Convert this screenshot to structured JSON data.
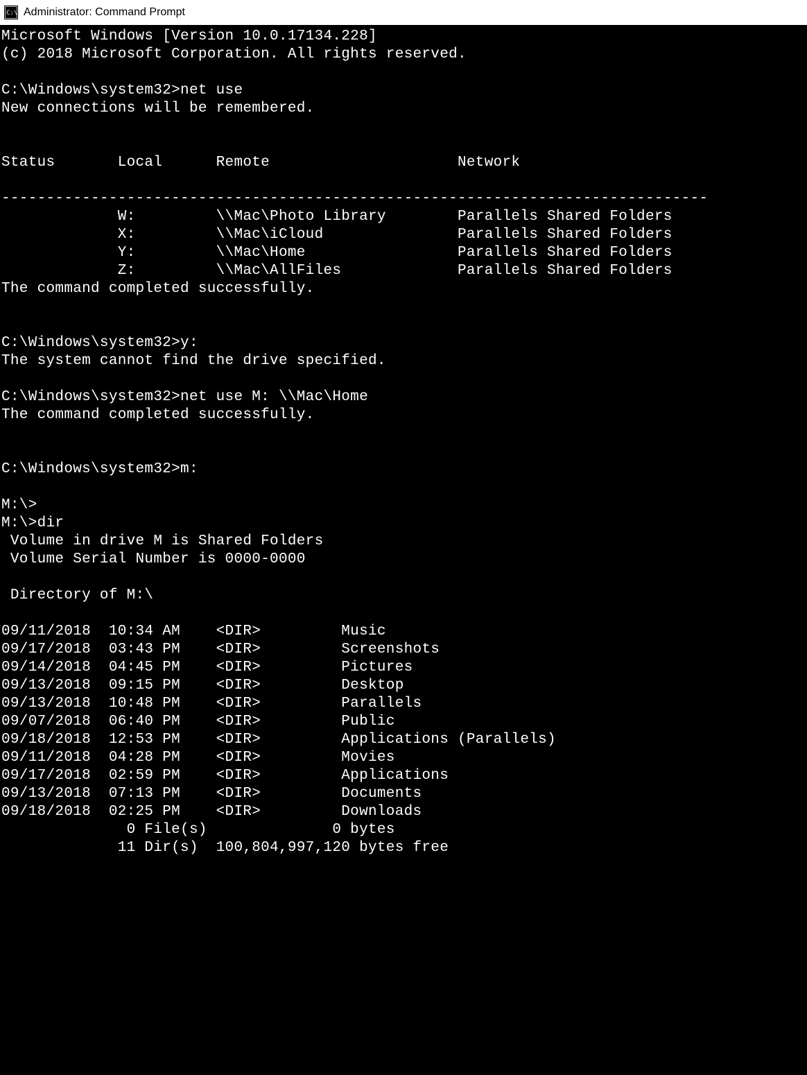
{
  "titlebar": {
    "title": "Administrator: Command Prompt"
  },
  "terminal": {
    "header_line1": "Microsoft Windows [Version 10.0.17134.228]",
    "header_line2": "(c) 2018 Microsoft Corporation. All rights reserved.",
    "prompt_path": "C:\\Windows\\system32>",
    "cmd_net_use": "net use",
    "net_use_msg": "New connections will be remembered.",
    "net_use_headers": {
      "status": "Status",
      "local": "Local",
      "remote": "Remote",
      "network": "Network"
    },
    "net_use_rows": [
      {
        "local": "W:",
        "remote": "\\\\Mac\\Photo Library",
        "network": "Parallels Shared Folders"
      },
      {
        "local": "X:",
        "remote": "\\\\Mac\\iCloud",
        "network": "Parallels Shared Folders"
      },
      {
        "local": "Y:",
        "remote": "\\\\Mac\\Home",
        "network": "Parallels Shared Folders"
      },
      {
        "local": "Z:",
        "remote": "\\\\Mac\\AllFiles",
        "network": "Parallels Shared Folders"
      }
    ],
    "cmd_success": "The command completed successfully.",
    "cmd_y": "y:",
    "err_drive": "The system cannot find the drive specified.",
    "cmd_net_use_m": "net use M: \\\\Mac\\Home",
    "cmd_m": "m:",
    "prompt_m": "M:\\>",
    "cmd_dir": "dir",
    "dir_vol1": " Volume in drive M is Shared Folders",
    "dir_vol2": " Volume Serial Number is 0000-0000",
    "dir_of": " Directory of M:\\",
    "dir_rows": [
      {
        "date": "09/11/2018",
        "time": "10:34 AM",
        "type": "<DIR>",
        "name": "Music"
      },
      {
        "date": "09/17/2018",
        "time": "03:43 PM",
        "type": "<DIR>",
        "name": "Screenshots"
      },
      {
        "date": "09/14/2018",
        "time": "04:45 PM",
        "type": "<DIR>",
        "name": "Pictures"
      },
      {
        "date": "09/13/2018",
        "time": "09:15 PM",
        "type": "<DIR>",
        "name": "Desktop"
      },
      {
        "date": "09/13/2018",
        "time": "10:48 PM",
        "type": "<DIR>",
        "name": "Parallels"
      },
      {
        "date": "09/07/2018",
        "time": "06:40 PM",
        "type": "<DIR>",
        "name": "Public"
      },
      {
        "date": "09/18/2018",
        "time": "12:53 PM",
        "type": "<DIR>",
        "name": "Applications (Parallels)"
      },
      {
        "date": "09/11/2018",
        "time": "04:28 PM",
        "type": "<DIR>",
        "name": "Movies"
      },
      {
        "date": "09/17/2018",
        "time": "02:59 PM",
        "type": "<DIR>",
        "name": "Applications"
      },
      {
        "date": "09/13/2018",
        "time": "07:13 PM",
        "type": "<DIR>",
        "name": "Documents"
      },
      {
        "date": "09/18/2018",
        "time": "02:25 PM",
        "type": "<DIR>",
        "name": "Downloads"
      }
    ],
    "dir_summary1_files": "0 File(s)",
    "dir_summary1_bytes": "0 bytes",
    "dir_summary2_dirs": "11 Dir(s)",
    "dir_summary2_free": "100,804,997,120 bytes free"
  }
}
